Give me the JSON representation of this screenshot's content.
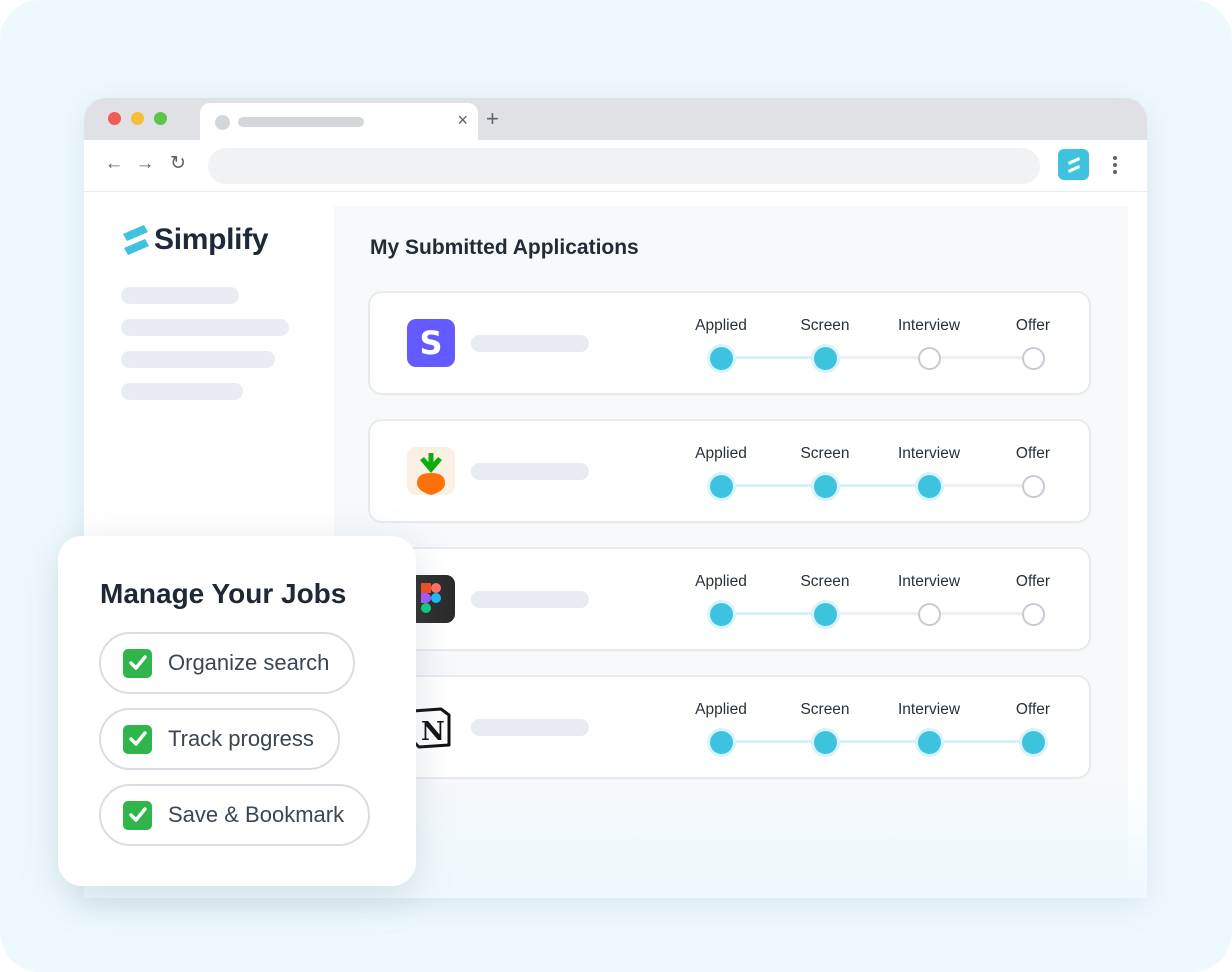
{
  "brand": {
    "name": "Simplify",
    "accent_color": "#3dc3de",
    "logo_icon": "simplify-logo-icon"
  },
  "browser": {
    "window_controls": [
      "close",
      "minimize",
      "maximize"
    ],
    "tab": {
      "close_glyph": "×"
    },
    "new_tab_glyph": "+",
    "toolbar": {
      "back_glyph": "←",
      "forward_glyph": "→",
      "reload_glyph": "↻",
      "extension_icon": "simplify-extension-icon",
      "menu_icon": "more-vertical-icon"
    }
  },
  "main": {
    "title": "My Submitted Applications",
    "stage_labels": [
      "Applied",
      "Screen",
      "Interview",
      "Offer"
    ],
    "applications": [
      {
        "company_icon": "stripe-logo",
        "stages_completed": 2,
        "stage_1": "Applied",
        "stage_2": "Screen",
        "stage_3": "Interview",
        "stage_4": "Offer"
      },
      {
        "company_icon": "instacart-logo",
        "stages_completed": 3,
        "stage_1": "Applied",
        "stage_2": "Screen",
        "stage_3": "Interview",
        "stage_4": "Offer"
      },
      {
        "company_icon": "figma-logo",
        "stages_completed": 2,
        "stage_1": "Applied",
        "stage_2": "Screen",
        "stage_3": "Interview",
        "stage_4": "Offer"
      },
      {
        "company_icon": "notion-logo",
        "stages_completed": 4,
        "stage_1": "Applied",
        "stage_2": "Screen",
        "stage_3": "Interview",
        "stage_4": "Offer"
      }
    ]
  },
  "feature_card": {
    "title": "Manage Your Jobs",
    "items": [
      {
        "icon": "check-box-icon",
        "label": "Organize search"
      },
      {
        "icon": "check-box-icon",
        "label": "Track progress"
      },
      {
        "icon": "check-box-icon",
        "label": "Save & Bookmark"
      }
    ]
  }
}
